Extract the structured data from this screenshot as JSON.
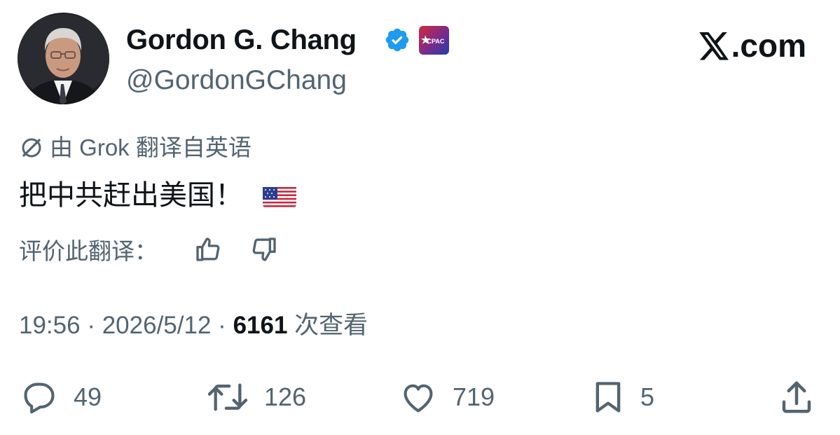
{
  "author": {
    "display_name": "Gordon G. Chang",
    "handle": "@GordonGChang",
    "verified_color": "#1d9bf0",
    "org_badge_label": "CPAC"
  },
  "brand": {
    "logo_suffix": ".com"
  },
  "translation": {
    "notice": "由 Grok 翻译自英语"
  },
  "tweet": {
    "text": "把中共赶出美国！",
    "emoji": "us-flag"
  },
  "rating": {
    "prompt": "评价此翻译："
  },
  "meta": {
    "time": "19:56",
    "date": "2026/5/12",
    "separator": "·",
    "views": "6161",
    "views_label": "次查看"
  },
  "actions": {
    "replies": "49",
    "reposts": "126",
    "likes": "719",
    "bookmarks": "5"
  },
  "colors": {
    "text": "#0f1419",
    "secondary": "#536471",
    "accent": "#1d9bf0"
  }
}
